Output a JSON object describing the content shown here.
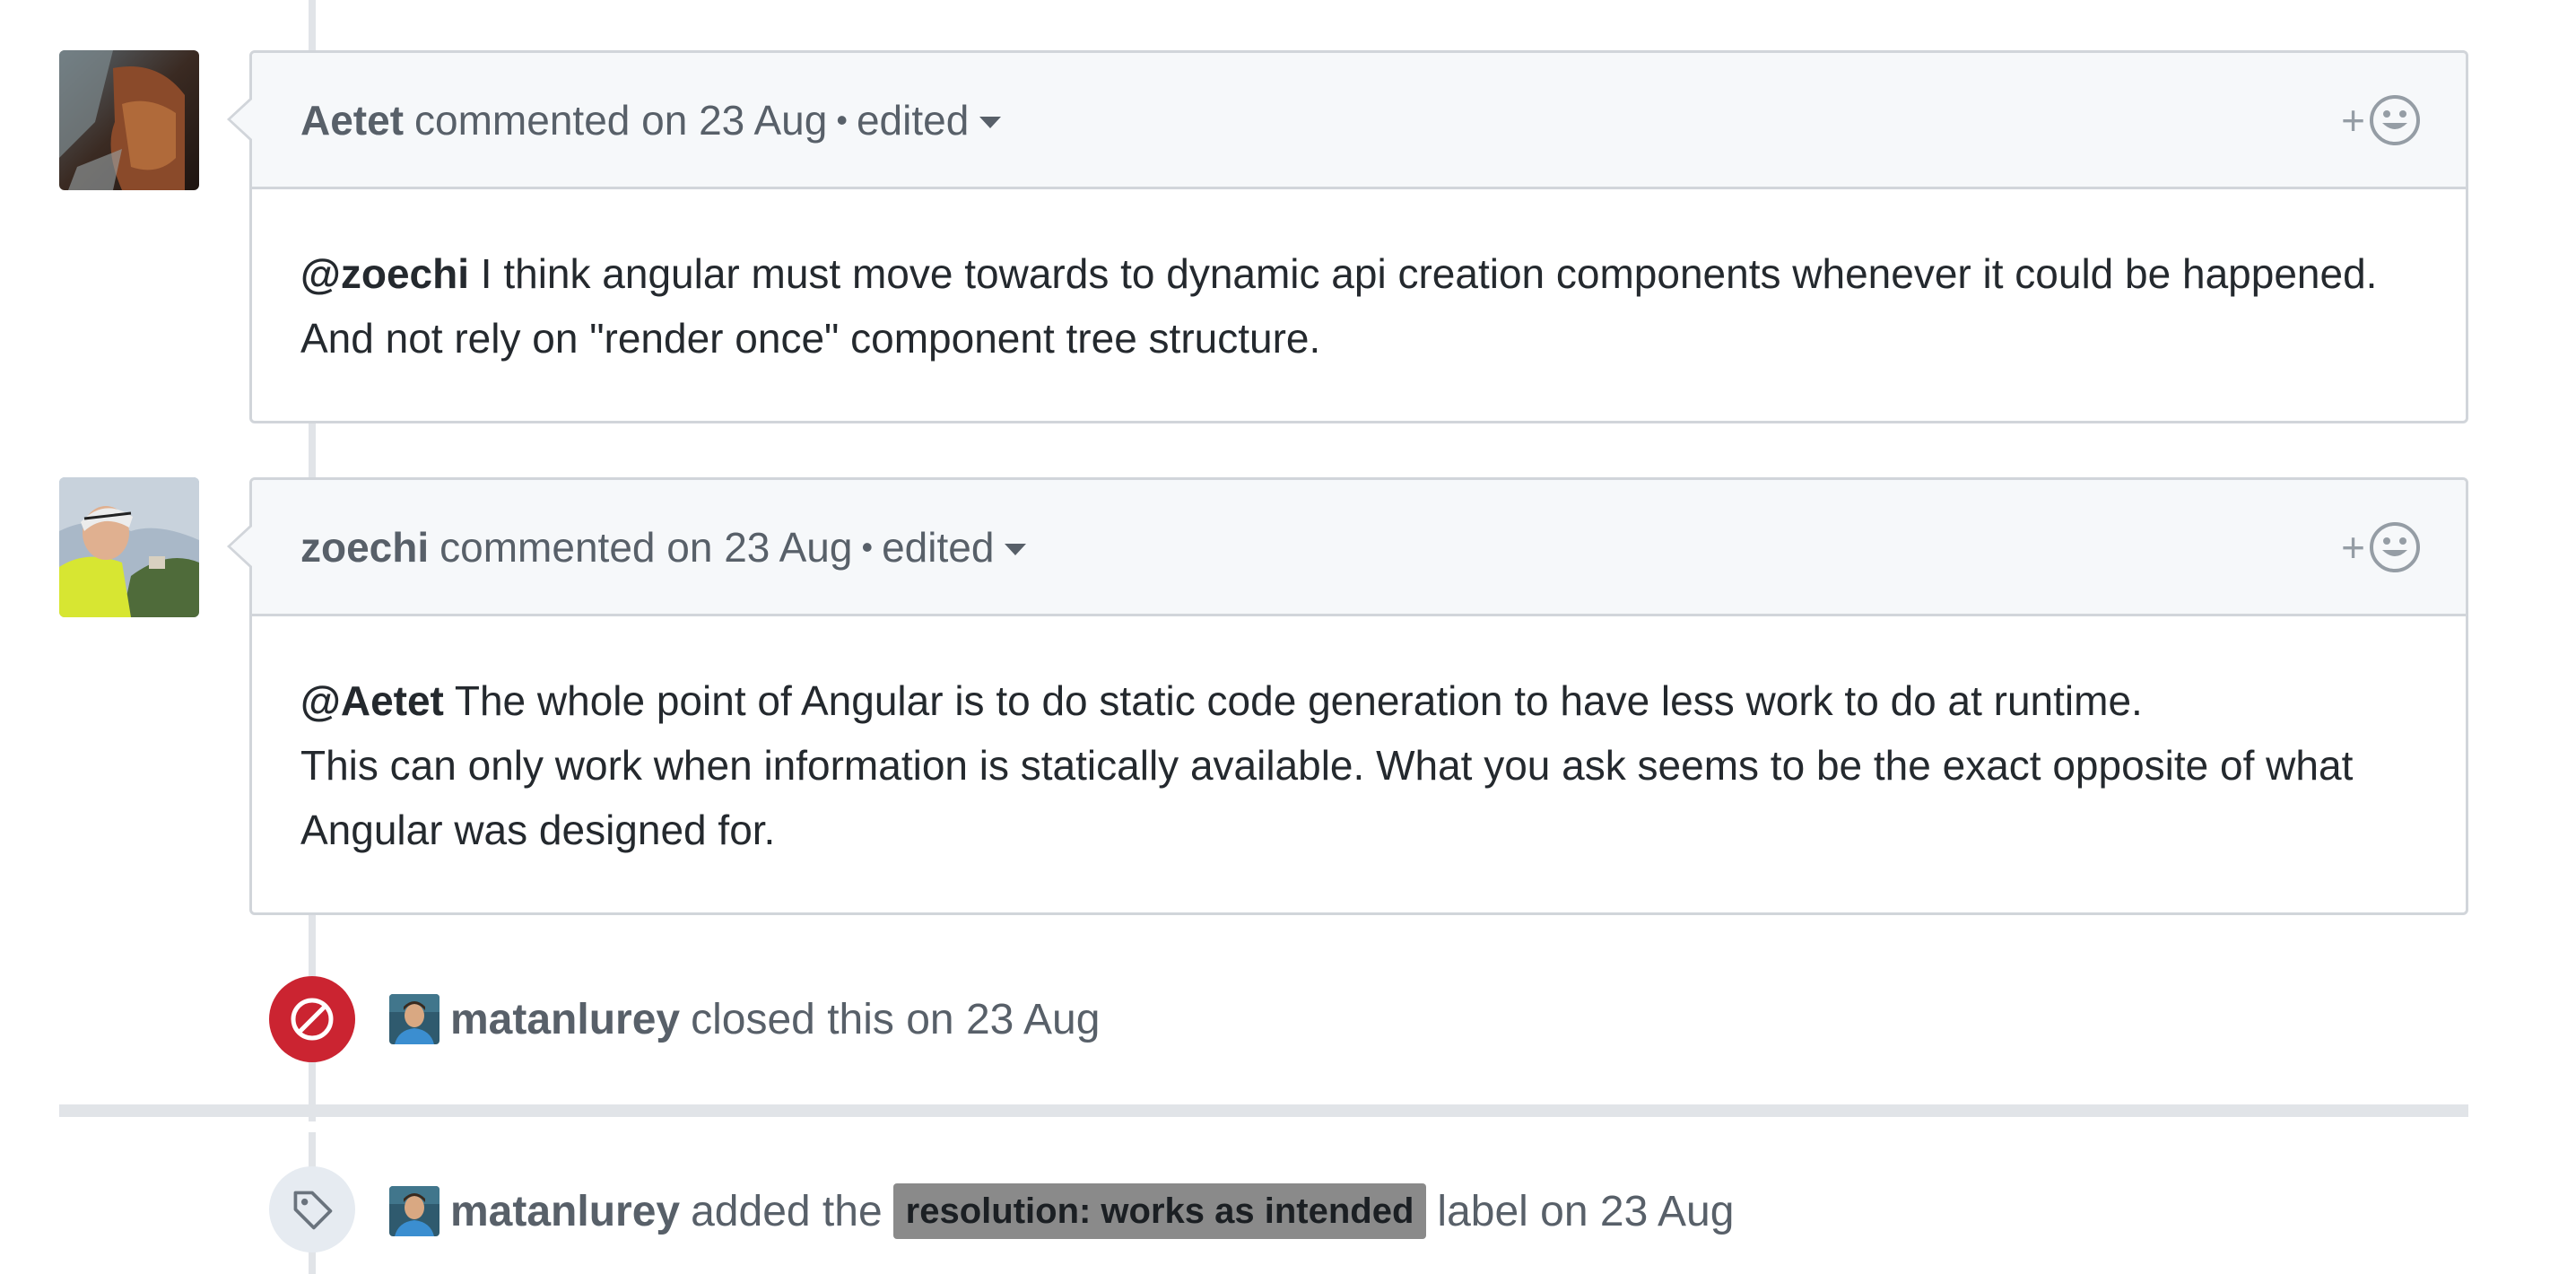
{
  "comments": [
    {
      "author": "Aetet",
      "meta": "commented on 23 Aug",
      "dot": "•",
      "edited": "edited",
      "reaction_plus": "+",
      "mention": "@zoechi",
      "lines": [
        " I think angular must move towards to dynamic api creation components whenever it could be happened.",
        "And not rely on \"render once\" component tree structure."
      ]
    },
    {
      "author": "zoechi",
      "meta": "commented on 23 Aug",
      "dot": "•",
      "edited": "edited",
      "reaction_plus": "+",
      "mention": "@Aetet",
      "lines": [
        " The whole point of Angular is to do static code generation to have less work to do at runtime.",
        "This can only work when information is statically available. What you ask seems to be the exact opposite of what",
        "Angular was designed for."
      ]
    }
  ],
  "events": [
    {
      "type": "closed",
      "icon": "circle-slash-icon",
      "badge_color": "#cb2431",
      "actor": "matanlurey",
      "text": "closed this on 23 Aug"
    },
    {
      "type": "labeled",
      "icon": "tag-icon",
      "badge_color": "#e6ebf1",
      "actor": "matanlurey",
      "text_before": "added the",
      "label": "resolution: works as intended",
      "label_color": "#8a8a8a",
      "text_after": "label on 23 Aug"
    }
  ]
}
